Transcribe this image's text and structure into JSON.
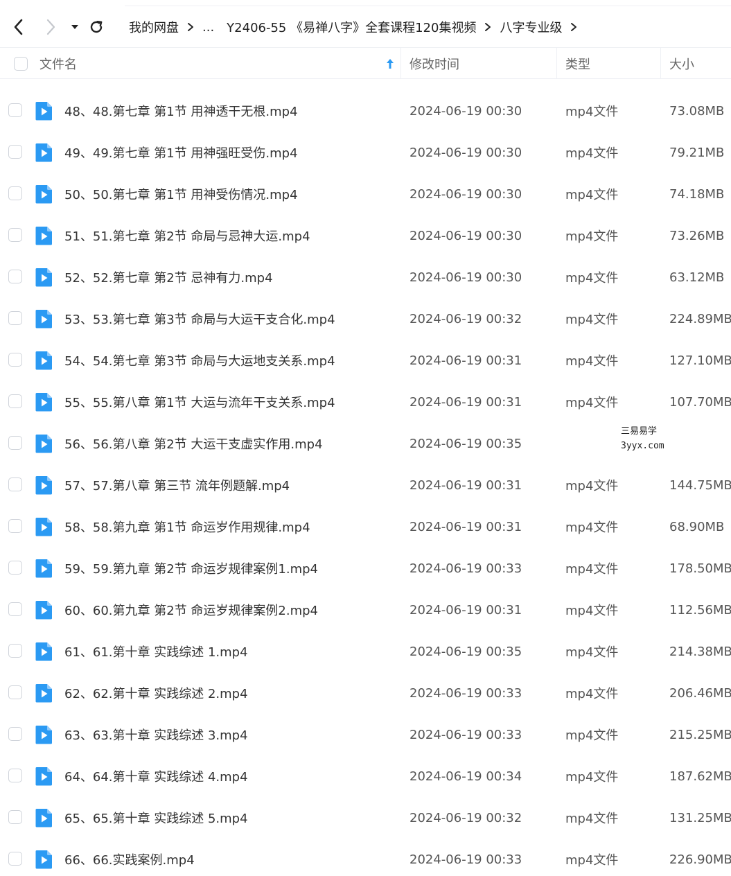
{
  "toolbar": {
    "breadcrumb": [
      "我的网盘",
      "...",
      "Y2406-55 《易禅八字》全套课程120集视频",
      "八字专业级"
    ]
  },
  "table": {
    "headers": {
      "name": "文件名",
      "modified": "修改时间",
      "type": "类型",
      "size": "大小"
    },
    "sort": "ascending"
  },
  "files": [
    {
      "name": "48、48.第七章 第1节 用神透干无根.mp4",
      "date": "2024-06-19 00:30",
      "type": "mp4文件",
      "size": "73.08MB"
    },
    {
      "name": "49、49.第七章 第1节 用神强旺受伤.mp4",
      "date": "2024-06-19 00:30",
      "type": "mp4文件",
      "size": "79.21MB"
    },
    {
      "name": "50、50.第七章 第1节 用神受伤情况.mp4",
      "date": "2024-06-19 00:30",
      "type": "mp4文件",
      "size": "74.18MB"
    },
    {
      "name": "51、51.第七章 第2节 命局与忌神大运.mp4",
      "date": "2024-06-19 00:30",
      "type": "mp4文件",
      "size": "73.26MB"
    },
    {
      "name": "52、52.第七章 第2节 忌神有力.mp4",
      "date": "2024-06-19 00:30",
      "type": "mp4文件",
      "size": "63.12MB"
    },
    {
      "name": "53、53.第七章 第3节 命局与大运干支合化.mp4",
      "date": "2024-06-19 00:32",
      "type": "mp4文件",
      "size": "224.89MB"
    },
    {
      "name": "54、54.第七章 第3节 命局与大运地支关系.mp4",
      "date": "2024-06-19 00:31",
      "type": "mp4文件",
      "size": "127.10MB"
    },
    {
      "name": "55、55.第八章 第1节 大运与流年干支关系.mp4",
      "date": "2024-06-19 00:31",
      "type": "mp4文件",
      "size": "107.70MB"
    },
    {
      "name": "56、56.第八章 第2节 大运干支虚实作用.mp4",
      "date": "2024-06-19 00:35",
      "type": "",
      "size": ""
    },
    {
      "name": "57、57.第八章 第三节 流年例题解.mp4",
      "date": "2024-06-19 00:31",
      "type": "mp4文件",
      "size": "144.75MB"
    },
    {
      "name": "58、58.第九章 第1节 命运岁作用规律.mp4",
      "date": "2024-06-19 00:31",
      "type": "mp4文件",
      "size": "68.90MB"
    },
    {
      "name": "59、59.第九章 第2节 命运岁规律案例1.mp4",
      "date": "2024-06-19 00:33",
      "type": "mp4文件",
      "size": "178.50MB"
    },
    {
      "name": "60、60.第九章 第2节 命运岁规律案例2.mp4",
      "date": "2024-06-19 00:31",
      "type": "mp4文件",
      "size": "112.56MB"
    },
    {
      "name": "61、61.第十章 实践综述 1.mp4",
      "date": "2024-06-19 00:35",
      "type": "mp4文件",
      "size": "214.38MB"
    },
    {
      "name": "62、62.第十章 实践综述 2.mp4",
      "date": "2024-06-19 00:33",
      "type": "mp4文件",
      "size": "206.46MB"
    },
    {
      "name": "63、63.第十章 实践综述 3.mp4",
      "date": "2024-06-19 00:33",
      "type": "mp4文件",
      "size": "215.25MB"
    },
    {
      "name": "64、64.第十章 实践综述 4.mp4",
      "date": "2024-06-19 00:34",
      "type": "mp4文件",
      "size": "187.62MB"
    },
    {
      "name": "65、65.第十章 实践综述 5.mp4",
      "date": "2024-06-19 00:32",
      "type": "mp4文件",
      "size": "131.25MB"
    },
    {
      "name": "66、66.实践案例.mp4",
      "date": "2024-06-19 00:33",
      "type": "mp4文件",
      "size": "226.90MB"
    }
  ],
  "watermark": {
    "line1": "三易易学",
    "line2": "3yyx.com"
  },
  "colors": {
    "file_icon": "#2b9af3",
    "sort_arrow": "#2b9af3",
    "divider": "#eef0f4"
  },
  "icons": {
    "back": "chevron-left-icon",
    "forward": "chevron-right-icon",
    "dropdown": "caret-down-icon",
    "refresh": "refresh-icon",
    "file": "video-file-icon",
    "sort": "arrow-up-icon"
  }
}
